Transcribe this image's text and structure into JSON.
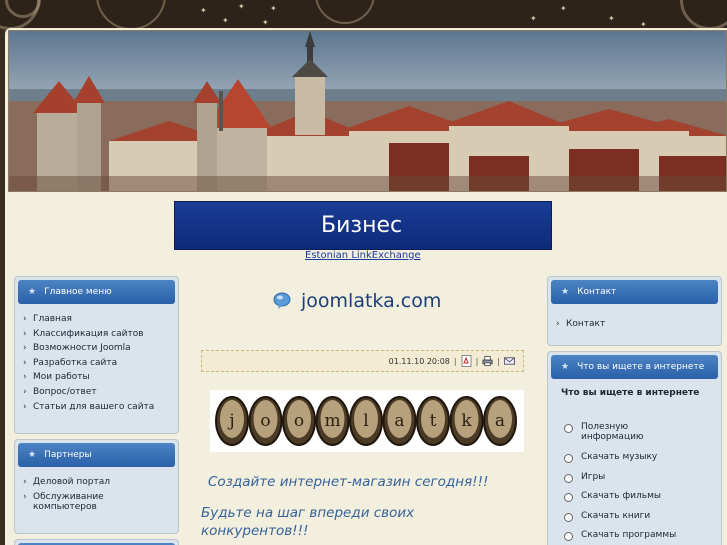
{
  "banner": {
    "title": "Бизнес",
    "link": "Estonian LinkExchange"
  },
  "main_menu": {
    "title": "Главное меню",
    "items": [
      "Главная",
      "Классификация сайтов",
      "Возможности Joomla",
      "Разработка сайта",
      "Мои работы",
      "Вопрос/ответ",
      "Статьи для вашего сайта"
    ]
  },
  "partners": {
    "title": "Партнеры",
    "items": [
      "Деловой портал",
      "Обслуживание компьютеров"
    ]
  },
  "contact_box": {
    "title": "Контакт",
    "items": [
      "Контакт"
    ]
  },
  "poll": {
    "title": "Что вы ищете в интернете",
    "question": "Что вы ищете в интернете",
    "options": [
      "Полезную информацию",
      "Скачать музыку",
      "Игры",
      "Скачать фильмы",
      "Скачать книги",
      "Скачать программы"
    ]
  },
  "article": {
    "site_title": "joomlatka.com",
    "date": "01.11.10 20:08",
    "logo_letters": [
      "j",
      "o",
      "o",
      "m",
      "l",
      "a",
      "t",
      "k",
      "a"
    ],
    "headline1": "Создайте интернет-магазин сегодня!!!",
    "headline2": "Будьте на шаг впереди своих конкурентов!!!"
  },
  "colors": {
    "accent_blue": "#2960a8",
    "banner_blue": "#1b3d96",
    "text_blue": "#35629a",
    "background": "#f3efdf"
  },
  "icons": {
    "box_header": "star-icon",
    "menu_bullet": "chevron-right-icon",
    "title": "chat-bubble-icon",
    "meta": [
      "pdf-icon",
      "print-icon",
      "email-icon"
    ]
  }
}
